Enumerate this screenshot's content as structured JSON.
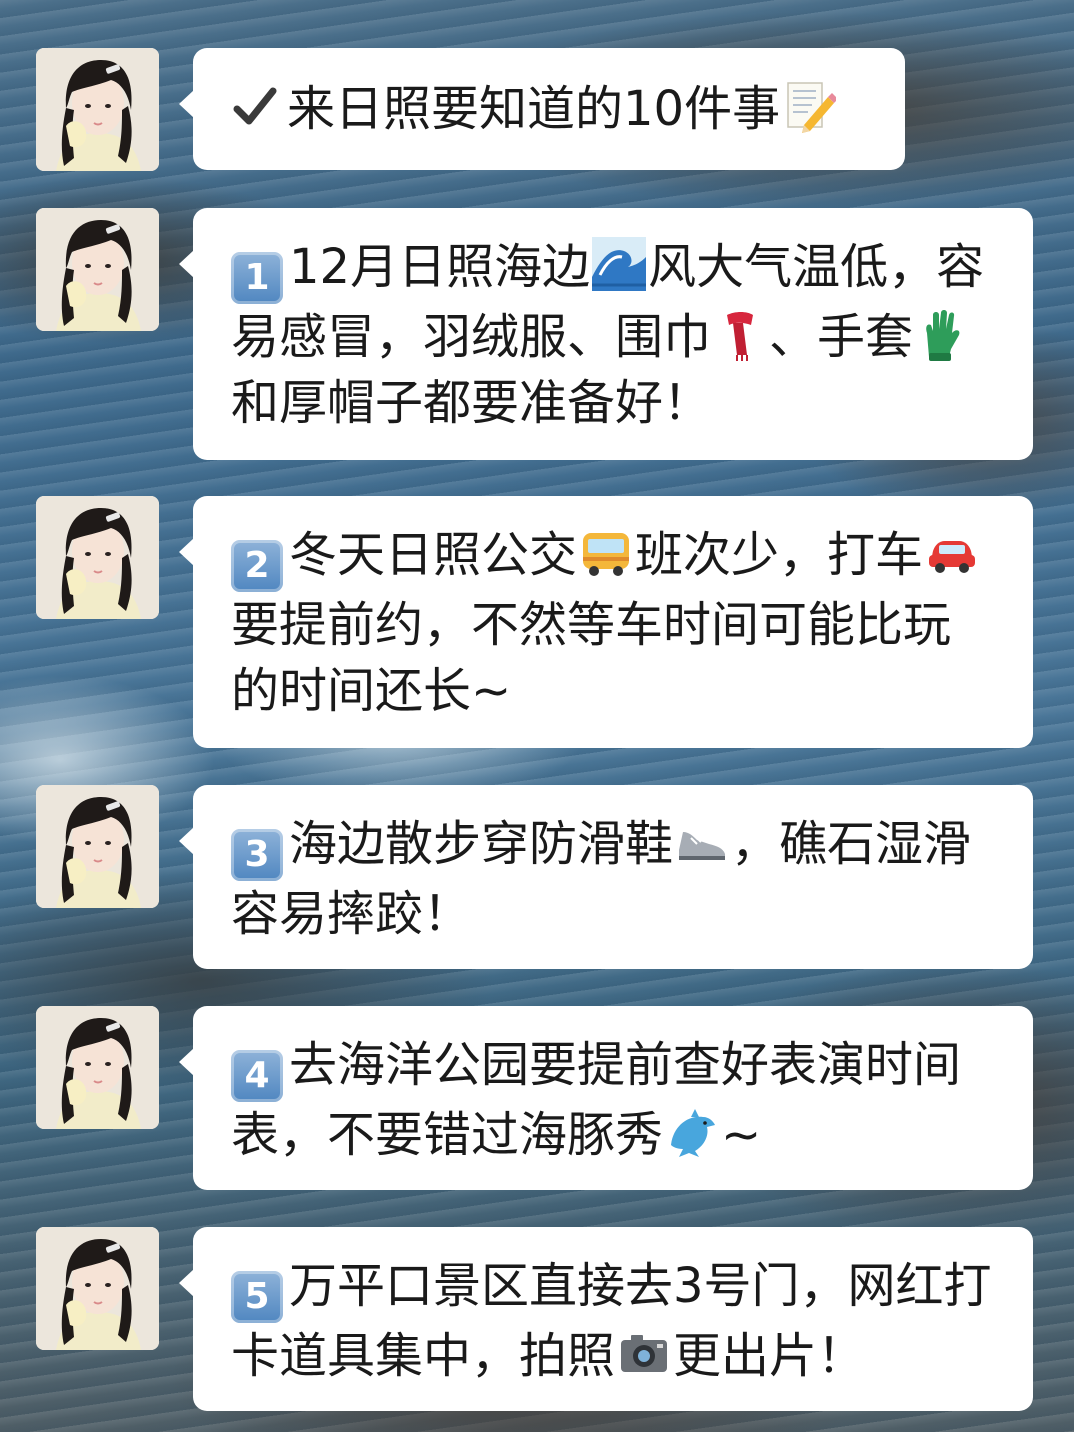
{
  "chat": {
    "messages": [
      {
        "badge": "",
        "pre_icon": "check-mark-icon",
        "text_parts": [
          "来日照要知道的10件事"
        ],
        "icons": [
          "memo-pencil-icon"
        ]
      },
      {
        "badge": "1",
        "text_parts": [
          "12月日照海边",
          "风大气温低，容易感冒，羽绒服、围巾",
          "、手套",
          "和厚帽子都要准备好！"
        ],
        "icons": [
          "wave-icon",
          "scarf-icon",
          "gloves-icon"
        ]
      },
      {
        "badge": "2",
        "text_parts": [
          "冬天日照公交",
          "班次少，打车",
          "要提前约，不然等车时间可能比玩的时间还长~"
        ],
        "icons": [
          "bus-icon",
          "car-icon"
        ]
      },
      {
        "badge": "3",
        "text_parts": [
          "海边散步穿防滑鞋",
          "，礁石湿滑容易摔跤！"
        ],
        "icons": [
          "sneaker-icon"
        ]
      },
      {
        "badge": "4",
        "text_parts": [
          "去海洋公园要提前查好表演时间表，不要错过海豚秀",
          "~"
        ],
        "icons": [
          "dolphin-icon"
        ]
      },
      {
        "badge": "5",
        "text_parts": [
          "万平口景区直接去3号门，网红打卡道具集中，拍照",
          "更出片！"
        ],
        "icons": [
          "camera-icon"
        ]
      }
    ]
  },
  "colors": {
    "bubble": "#ffffff",
    "text": "#1a1a1a",
    "badge": "#4f86c0"
  }
}
